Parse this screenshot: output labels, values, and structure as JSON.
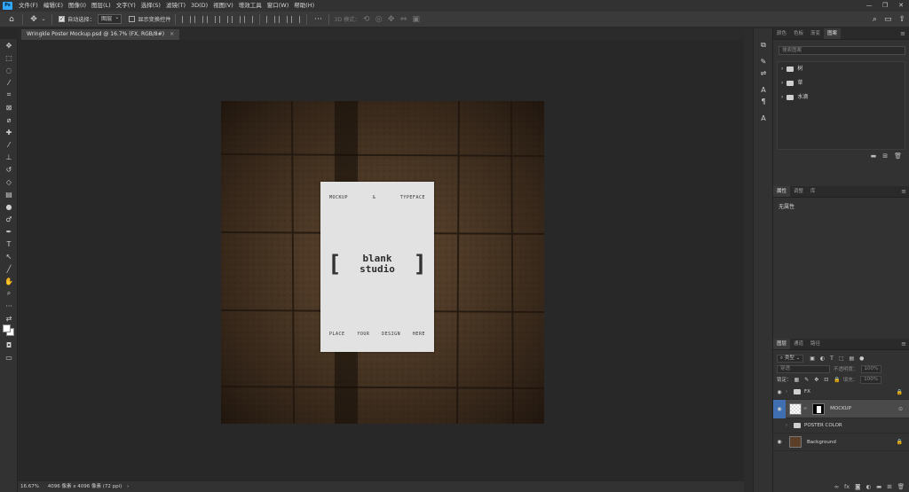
{
  "menubar": {
    "app_logo": "Ps",
    "items": [
      "文件(F)",
      "编辑(E)",
      "图像(I)",
      "图层(L)",
      "文字(Y)",
      "选择(S)",
      "滤镜(T)",
      "3D(D)",
      "视图(V)",
      "增效工具",
      "窗口(W)",
      "帮助(H)"
    ],
    "window_controls": [
      "—",
      "❐",
      "✕"
    ]
  },
  "options": {
    "auto_select_label": "自动选择：",
    "auto_select_value": "图层",
    "show_transform_label": "显示变换控件",
    "mode_3d_label": "3D 模式："
  },
  "document": {
    "tab_title": "Wringkle Poster Mockup.psd @ 16.7% (FX, RGB/8#)"
  },
  "poster": {
    "top_left": "MOCKUP",
    "top_mid": "&",
    "top_right": "TYPEFACE",
    "bracket_left": "[",
    "bracket_right": "]",
    "line1": "blank",
    "line2": "studio",
    "bottom": [
      "PLACE",
      "YOUR",
      "DESIGN",
      "HERE"
    ]
  },
  "status": {
    "zoom": "16.67%",
    "doc_info": "4096 像素 x 4096 像素 (72 ppi)"
  },
  "libraries_panel": {
    "tabs": [
      "颜色",
      "色板",
      "渐变",
      "图案"
    ],
    "active_tab": "图案",
    "search_placeholder": "搜索图案",
    "items": [
      "树",
      "草",
      "水滴"
    ]
  },
  "properties_panel": {
    "tabs": [
      "属性",
      "调整",
      "库"
    ],
    "active_tab": "属性",
    "content": "无属性"
  },
  "layers_panel": {
    "tabs": [
      "图层",
      "通道",
      "路径"
    ],
    "active_tab": "图层",
    "filter_kind": "类型",
    "blend_mode": "穿透",
    "opacity_label": "不透明度：",
    "opacity_value": "100%",
    "lock_label": "锁定：",
    "fill_label": "填充：",
    "fill_value": "100%",
    "layers": [
      {
        "name": "FX",
        "type": "group",
        "visible": true,
        "locked": true
      },
      {
        "name": "MOCKUP",
        "type": "smart",
        "visible": true,
        "selected": true
      },
      {
        "name": "POSTER COLOR",
        "type": "group",
        "visible": false
      },
      {
        "name": "Background",
        "type": "image",
        "visible": true,
        "locked": true
      }
    ]
  },
  "colors": {
    "accent_ps": "#31a8ff",
    "wall": "#4a3522",
    "poster_paper": "#e2e2e2",
    "selected_layer": "#4a4a4a"
  }
}
